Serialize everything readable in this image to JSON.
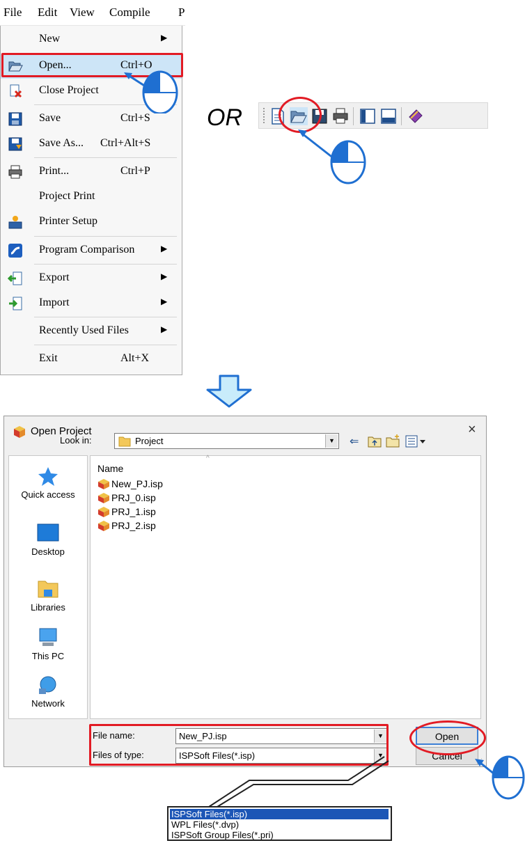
{
  "menu": {
    "bar": [
      "File",
      "Edit",
      "View",
      "Compile",
      "P"
    ],
    "items": [
      {
        "label": "New",
        "shortcut": "",
        "submenu": true
      },
      {
        "label": "Open...",
        "shortcut": "Ctrl+O",
        "submenu": false
      },
      {
        "label": "Close Project",
        "shortcut": "",
        "submenu": false
      },
      {
        "label": "Save",
        "shortcut": "Ctrl+S",
        "submenu": false
      },
      {
        "label": "Save As...",
        "shortcut": "Ctrl+Alt+S",
        "submenu": false
      },
      {
        "label": "Print...",
        "shortcut": "Ctrl+P",
        "submenu": false
      },
      {
        "label": "Project Print",
        "shortcut": "",
        "submenu": false
      },
      {
        "label": "Printer Setup",
        "shortcut": "",
        "submenu": false
      },
      {
        "label": "Program Comparison",
        "shortcut": "",
        "submenu": true
      },
      {
        "label": "Export",
        "shortcut": "",
        "submenu": true
      },
      {
        "label": "Import",
        "shortcut": "",
        "submenu": true
      },
      {
        "label": "Recently Used Files",
        "shortcut": "",
        "submenu": true
      },
      {
        "label": "Exit",
        "shortcut": "Alt+X",
        "submenu": false
      }
    ]
  },
  "or_label": "OR",
  "dialog": {
    "title": "Open Project",
    "close": "×",
    "look_in_label": "Look in:",
    "look_in_value": "Project",
    "places": [
      "Quick access",
      "Desktop",
      "Libraries",
      "This PC",
      "Network"
    ],
    "column_name": "Name",
    "files": [
      "New_PJ.isp",
      "PRJ_0.isp",
      "PRJ_1.isp",
      "PRJ_2.isp"
    ],
    "file_name_label": "File name:",
    "file_name_value": "New_PJ.isp",
    "file_type_label": "Files of type:",
    "file_type_value": "ISPSoft Files(*.isp)",
    "open_button": "Open",
    "cancel_button": "Cancel"
  },
  "filetype_options": [
    "ISPSoft Files(*.isp)",
    "WPL Files(*.dvp)",
    "ISPSoft Group Files(*.pri)"
  ],
  "colors": {
    "highlight_red": "#e21b24",
    "pointer_blue": "#1f6fd1",
    "arrow_fill": "#c9ecfb",
    "selection": "#1c56b6"
  }
}
